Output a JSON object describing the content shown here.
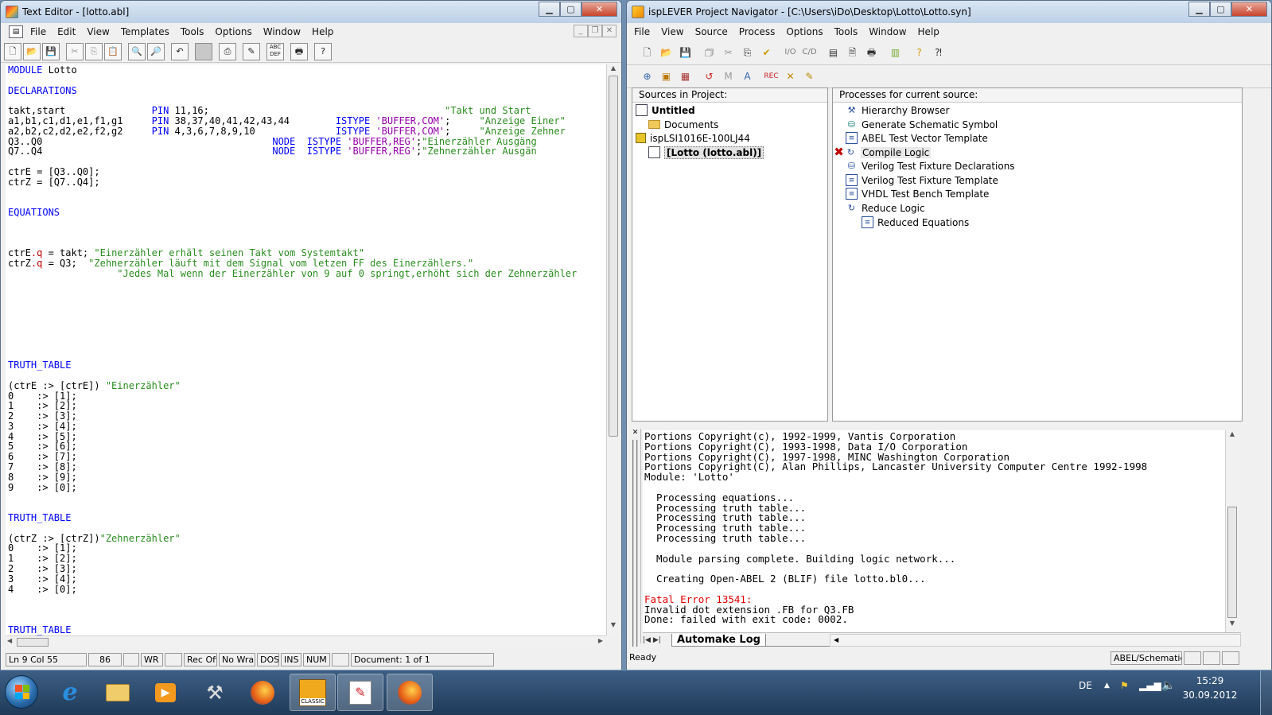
{
  "left_window": {
    "title": "Text Editor - [lotto.abl]",
    "menu": [
      "File",
      "Edit",
      "View",
      "Templates",
      "Tools",
      "Options",
      "Window",
      "Help"
    ],
    "toolbar_icons": [
      "new-file-icon",
      "open-folder-icon",
      "save-icon",
      "cut-icon",
      "copy-icon",
      "paste-icon",
      "find-icon",
      "find-replace-icon",
      "undo-icon",
      "blank-icon",
      "insert-template-icon",
      "edit-tool-icon",
      "abc-icon",
      "print-icon",
      "help-icon"
    ],
    "status": [
      "Ln 9 Col 55",
      "86",
      "WR",
      "Rec Off",
      "No Wrap",
      "DOS",
      "INS",
      "NUM",
      "Document: 1 of 1"
    ]
  },
  "code_lines": [
    [
      {
        "t": "MODULE",
        "c": "kw"
      },
      {
        "t": " Lotto",
        "c": ""
      }
    ],
    [],
    [
      {
        "t": "DECLARATIONS",
        "c": "kw"
      }
    ],
    [],
    [
      {
        "t": "takt,start               ",
        "c": ""
      },
      {
        "t": "PIN",
        "c": "kw"
      },
      {
        "t": " 11,16;                                         ",
        "c": ""
      },
      {
        "t": "\"Takt und Start",
        "c": "str"
      }
    ],
    [
      {
        "t": "a1,b1,c1,d1,e1,f1,g1     ",
        "c": ""
      },
      {
        "t": "PIN",
        "c": "kw"
      },
      {
        "t": " 38,37,40,41,42,43,44        ",
        "c": ""
      },
      {
        "t": "ISTYPE",
        "c": "kw"
      },
      {
        "t": " ",
        "c": ""
      },
      {
        "t": "'BUFFER,COM'",
        "c": "pur"
      },
      {
        "t": ";     ",
        "c": ""
      },
      {
        "t": "\"Anzeige Einer\"",
        "c": "str"
      }
    ],
    [
      {
        "t": "a2,b2,c2,d2,e2,f2,g2     ",
        "c": ""
      },
      {
        "t": "PIN",
        "c": "kw"
      },
      {
        "t": " 4,3,6,7,8,9,10              ",
        "c": ""
      },
      {
        "t": "ISTYPE",
        "c": "kw"
      },
      {
        "t": " ",
        "c": ""
      },
      {
        "t": "'BUFFER,COM'",
        "c": "pur"
      },
      {
        "t": ";     ",
        "c": ""
      },
      {
        "t": "\"Anzeige Zehner",
        "c": "str"
      }
    ],
    [
      {
        "t": "Q3..Q0                                        ",
        "c": ""
      },
      {
        "t": "NODE",
        "c": "kw"
      },
      {
        "t": "  ",
        "c": ""
      },
      {
        "t": "ISTYPE",
        "c": "kw"
      },
      {
        "t": " ",
        "c": ""
      },
      {
        "t": "'BUFFER,REG'",
        "c": "pur"
      },
      {
        "t": ";",
        "c": ""
      },
      {
        "t": "\"Einerzähler Ausgäng",
        "c": "str"
      }
    ],
    [
      {
        "t": "Q7..Q4                                        ",
        "c": ""
      },
      {
        "t": "NODE",
        "c": "kw"
      },
      {
        "t": "  ",
        "c": ""
      },
      {
        "t": "ISTYPE",
        "c": "kw"
      },
      {
        "t": " ",
        "c": ""
      },
      {
        "t": "'BUFFER,REG'",
        "c": "pur"
      },
      {
        "t": ";",
        "c": ""
      },
      {
        "t": "\"Zehnerzähler Ausgän",
        "c": "str"
      }
    ],
    [],
    [
      {
        "t": "ctrE = [Q3..Q0];",
        "c": ""
      }
    ],
    [
      {
        "t": "ctrZ = [Q7..Q4];",
        "c": ""
      }
    ],
    [],
    [],
    [
      {
        "t": "EQUATIONS",
        "c": "kw"
      }
    ],
    [],
    [],
    [],
    [
      {
        "t": "ctrE",
        "c": ""
      },
      {
        "t": ".q",
        "c": "red"
      },
      {
        "t": " = takt; ",
        "c": ""
      },
      {
        "t": "\"Einerzähler erhält seinen Takt vom Systemtakt\"",
        "c": "str"
      }
    ],
    [
      {
        "t": "ctrZ",
        "c": ""
      },
      {
        "t": ".q",
        "c": "red"
      },
      {
        "t": " = Q3;  ",
        "c": ""
      },
      {
        "t": "\"Zehnerzähler läuft mit dem Signal vom letzen FF des Einerzählers.\"",
        "c": "str"
      }
    ],
    [
      {
        "t": "                   ",
        "c": ""
      },
      {
        "t": "\"Jedes Mal wenn der Einerzähler von 9 auf 0 springt,erhöht sich der Zehnerzähler",
        "c": "str"
      }
    ],
    [],
    [],
    [],
    [],
    [],
    [],
    [],
    [],
    [
      {
        "t": "TRUTH_TABLE",
        "c": "kw"
      }
    ],
    [],
    [
      {
        "t": "(ctrE :> [ctrE]) ",
        "c": ""
      },
      {
        "t": "\"Einerzähler\"",
        "c": "str"
      }
    ],
    [
      {
        "t": "0    :> [1];",
        "c": ""
      }
    ],
    [
      {
        "t": "1    :> [2];",
        "c": ""
      }
    ],
    [
      {
        "t": "2    :> [3];",
        "c": ""
      }
    ],
    [
      {
        "t": "3    :> [4];",
        "c": ""
      }
    ],
    [
      {
        "t": "4    :> [5];",
        "c": ""
      }
    ],
    [
      {
        "t": "5    :> [6];",
        "c": ""
      }
    ],
    [
      {
        "t": "6    :> [7];",
        "c": ""
      }
    ],
    [
      {
        "t": "7    :> [8];",
        "c": ""
      }
    ],
    [
      {
        "t": "8    :> [9];",
        "c": ""
      }
    ],
    [
      {
        "t": "9    :> [0];",
        "c": ""
      }
    ],
    [],
    [],
    [
      {
        "t": "TRUTH_TABLE",
        "c": "kw"
      }
    ],
    [],
    [
      {
        "t": "(ctrZ :> [ctrZ])",
        "c": ""
      },
      {
        "t": "\"Zehnerzähler\"",
        "c": "str"
      }
    ],
    [
      {
        "t": "0    :> [1];",
        "c": ""
      }
    ],
    [
      {
        "t": "1    :> [2];",
        "c": ""
      }
    ],
    [
      {
        "t": "2    :> [3];",
        "c": ""
      }
    ],
    [
      {
        "t": "3    :> [4];",
        "c": ""
      }
    ],
    [
      {
        "t": "4    :> [0];",
        "c": ""
      }
    ],
    [],
    [],
    [],
    [
      {
        "t": "TRUTH_TABLE",
        "c": "kw"
      }
    ]
  ],
  "right_window": {
    "title": "ispLEVER Project Navigator - [C:\\Users\\iDo\\Desktop\\Lotto\\Lotto.syn]",
    "menu": [
      "File",
      "View",
      "Source",
      "Process",
      "Options",
      "Tools",
      "Window",
      "Help"
    ],
    "sources_header": "Sources in Project:",
    "sources": [
      "Untitled",
      "Documents",
      "ispLSI1016E-100LJ44",
      "[Lotto (lotto.abl)]"
    ],
    "processes_header": "Processes for current source:",
    "processes": [
      "Hierarchy Browser",
      "Generate Schematic Symbol",
      "ABEL Test Vector Template",
      "Compile Logic",
      "Verilog Test Fixture Declarations",
      "Verilog Test Fixture Template",
      "VHDL Test Bench Template",
      "Reduce Logic",
      "Reduced Equations"
    ],
    "log_lines": [
      {
        "t": "Portions Copyright(c), 1992-1999, Vantis Corporation",
        "c": ""
      },
      {
        "t": "Portions Copyright(C), 1993-1998, Data I/O Corporation",
        "c": ""
      },
      {
        "t": "Portions Copyright(C), 1997-1998, MINC Washington Corporation",
        "c": ""
      },
      {
        "t": "Portions Copyright(C), Alan Phillips, Lancaster University Computer Centre 1992-1998",
        "c": ""
      },
      {
        "t": "Module: 'Lotto'",
        "c": ""
      },
      {
        "t": "",
        "c": ""
      },
      {
        "t": "  Processing equations...",
        "c": ""
      },
      {
        "t": "  Processing truth table...",
        "c": ""
      },
      {
        "t": "  Processing truth table...",
        "c": ""
      },
      {
        "t": "  Processing truth table...",
        "c": ""
      },
      {
        "t": "  Processing truth table...",
        "c": ""
      },
      {
        "t": "",
        "c": ""
      },
      {
        "t": "  Module parsing complete. Building logic network...",
        "c": ""
      },
      {
        "t": "",
        "c": ""
      },
      {
        "t": "  Creating Open-ABEL 2 (BLIF) file lotto.bl0...",
        "c": ""
      },
      {
        "t": "",
        "c": ""
      },
      {
        "t": "Fatal Error 13541:",
        "c": "red"
      },
      {
        "t": "Invalid dot extension .FB for Q3.FB",
        "c": ""
      },
      {
        "t": "Done: failed with exit code: 0002.",
        "c": ""
      }
    ],
    "log_tab": "Automake Log",
    "status_ready": "Ready",
    "status_mode": "ABEL/Schematic"
  },
  "tray": {
    "lang": "DE",
    "time": "15:29",
    "date": "30.09.2012"
  },
  "toolbar2_labels": {
    "io": "I/O",
    "cd": "C/D"
  },
  "taskbar_classic_label": "CLASSIC"
}
